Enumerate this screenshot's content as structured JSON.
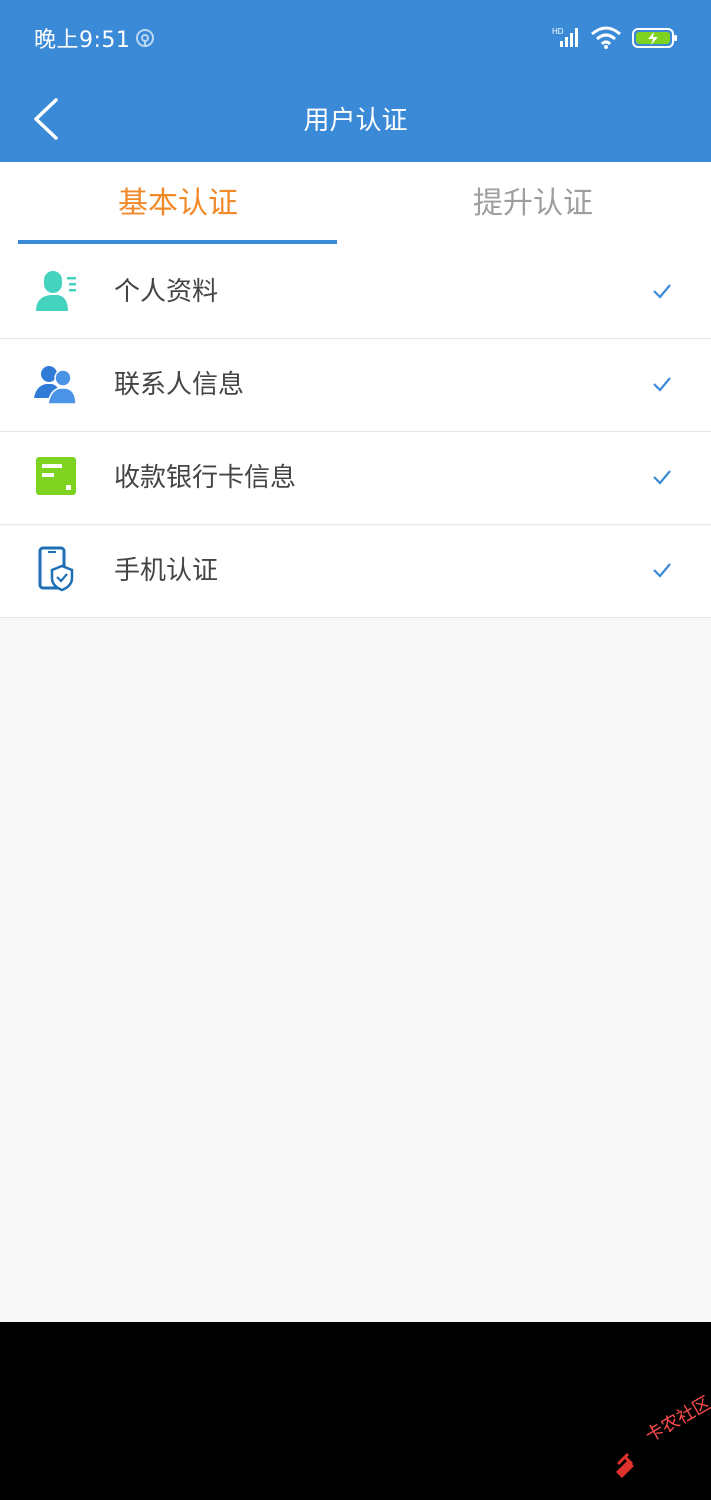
{
  "status_bar": {
    "time": "晚上9:51",
    "signal_label": "HD"
  },
  "header": {
    "title": "用户认证"
  },
  "tabs": [
    {
      "label": "基本认证",
      "active": true
    },
    {
      "label": "提升认证",
      "active": false
    }
  ],
  "items": [
    {
      "label": "个人资料",
      "icon": "personal-info-icon",
      "done": true
    },
    {
      "label": "联系人信息",
      "icon": "contacts-icon",
      "done": true
    },
    {
      "label": "收款银行卡信息",
      "icon": "bank-card-icon",
      "done": true
    },
    {
      "label": "手机认证",
      "icon": "phone-verify-icon",
      "done": true
    }
  ],
  "colors": {
    "primary": "#3a8ad8",
    "tab_active": "#f08a2a",
    "tab_inactive": "#9e9e9e",
    "check": "#3a8ad8",
    "personal_icon": "#44d3be",
    "contacts_icon": "#2f7bd6",
    "bank_icon": "#7ed321",
    "phone_icon": "#1f6fb5"
  },
  "watermark": {
    "text": "卡农社区"
  }
}
